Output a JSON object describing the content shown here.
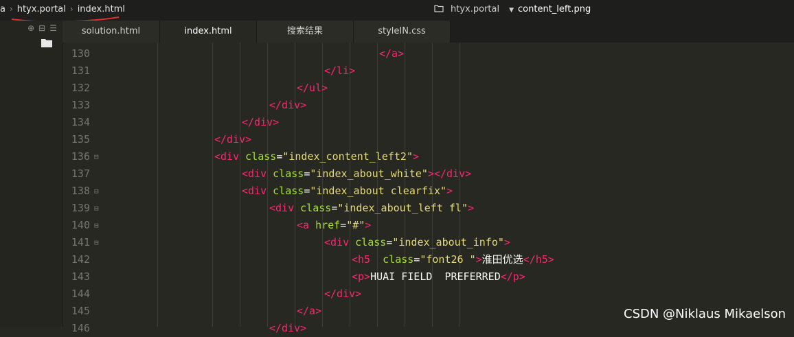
{
  "breadcrumb": {
    "root_fragment": "a",
    "project": "htyx.portal",
    "file": "index.html"
  },
  "right_info": {
    "project": "htyx.portal",
    "file": "content_left.png"
  },
  "tabs": [
    {
      "label": "solution.html",
      "active": false
    },
    {
      "label": "index.html",
      "active": true
    },
    {
      "label": "搜索结果",
      "active": false
    },
    {
      "label": "styleIN.css",
      "active": false
    }
  ],
  "lines": [
    {
      "num": "130",
      "fold": false,
      "indent": 14,
      "parts": [
        {
          "t": "tag",
          "v": "</a>"
        }
      ]
    },
    {
      "num": "131",
      "fold": false,
      "indent": 12,
      "parts": [
        {
          "t": "tag",
          "v": "</li>"
        }
      ]
    },
    {
      "num": "132",
      "fold": false,
      "indent": 11,
      "parts": [
        {
          "t": "tag",
          "v": "</ul>"
        }
      ]
    },
    {
      "num": "133",
      "fold": false,
      "indent": 10,
      "parts": [
        {
          "t": "tag",
          "v": "</div>"
        }
      ]
    },
    {
      "num": "134",
      "fold": false,
      "indent": 9,
      "parts": [
        {
          "t": "tag",
          "v": "</div>"
        }
      ]
    },
    {
      "num": "135",
      "fold": false,
      "indent": 8,
      "parts": [
        {
          "t": "tag",
          "v": "</div>"
        }
      ]
    },
    {
      "num": "136",
      "fold": true,
      "indent": 8,
      "parts": [
        {
          "t": "tag",
          "v": "<div "
        },
        {
          "t": "attr",
          "v": "class"
        },
        {
          "t": "txt",
          "v": "="
        },
        {
          "t": "str",
          "v": "\"index_content_left2\""
        },
        {
          "t": "tag",
          "v": ">"
        }
      ]
    },
    {
      "num": "137",
      "fold": false,
      "indent": 9,
      "parts": [
        {
          "t": "tag",
          "v": "<div "
        },
        {
          "t": "attr",
          "v": "class"
        },
        {
          "t": "txt",
          "v": "="
        },
        {
          "t": "str",
          "v": "\"index_about_white\""
        },
        {
          "t": "tag",
          "v": "></div>"
        }
      ]
    },
    {
      "num": "138",
      "fold": true,
      "indent": 9,
      "parts": [
        {
          "t": "tag",
          "v": "<div "
        },
        {
          "t": "attr",
          "v": "class"
        },
        {
          "t": "txt",
          "v": "="
        },
        {
          "t": "str",
          "v": "\"index_about clearfix\""
        },
        {
          "t": "tag",
          "v": ">"
        }
      ]
    },
    {
      "num": "139",
      "fold": true,
      "indent": 10,
      "parts": [
        {
          "t": "tag",
          "v": "<div "
        },
        {
          "t": "attr",
          "v": "class"
        },
        {
          "t": "txt",
          "v": "="
        },
        {
          "t": "str",
          "v": "\"index_about_left fl\""
        },
        {
          "t": "tag",
          "v": ">"
        }
      ]
    },
    {
      "num": "140",
      "fold": true,
      "indent": 11,
      "parts": [
        {
          "t": "tag",
          "v": "<a "
        },
        {
          "t": "attr",
          "v": "href"
        },
        {
          "t": "txt",
          "v": "="
        },
        {
          "t": "str",
          "v": "\"#\""
        },
        {
          "t": "tag",
          "v": ">"
        }
      ]
    },
    {
      "num": "141",
      "fold": true,
      "indent": 12,
      "parts": [
        {
          "t": "tag",
          "v": "<div "
        },
        {
          "t": "attr",
          "v": "class"
        },
        {
          "t": "txt",
          "v": "="
        },
        {
          "t": "str",
          "v": "\"index_about_info\""
        },
        {
          "t": "tag",
          "v": ">"
        }
      ]
    },
    {
      "num": "142",
      "fold": false,
      "indent": 13,
      "parts": [
        {
          "t": "tag",
          "v": "<h5  "
        },
        {
          "t": "attr",
          "v": "class"
        },
        {
          "t": "txt",
          "v": "="
        },
        {
          "t": "str",
          "v": "\"font26 \""
        },
        {
          "t": "tag",
          "v": ">"
        },
        {
          "t": "txt",
          "v": "淮田优选"
        },
        {
          "t": "tag",
          "v": "</h5>"
        }
      ]
    },
    {
      "num": "143",
      "fold": false,
      "indent": 13,
      "parts": [
        {
          "t": "tag",
          "v": "<p>"
        },
        {
          "t": "txt",
          "v": "HUAI FIELD  PREFERRED"
        },
        {
          "t": "tag",
          "v": "</p>"
        }
      ]
    },
    {
      "num": "144",
      "fold": false,
      "indent": 12,
      "parts": [
        {
          "t": "tag",
          "v": "</div>"
        }
      ]
    },
    {
      "num": "145",
      "fold": false,
      "indent": 11,
      "parts": [
        {
          "t": "tag",
          "v": "</a>"
        }
      ]
    },
    {
      "num": "146",
      "fold": false,
      "indent": 10,
      "parts": [
        {
          "t": "tag",
          "v": "</div>"
        }
      ]
    }
  ],
  "watermark": "CSDN @Niklaus Mikaelson",
  "colors": {
    "background": "#272822",
    "tag": "#f92672",
    "attr": "#a6e22e",
    "string": "#e6db74",
    "annotation_underline": "#e03030"
  }
}
